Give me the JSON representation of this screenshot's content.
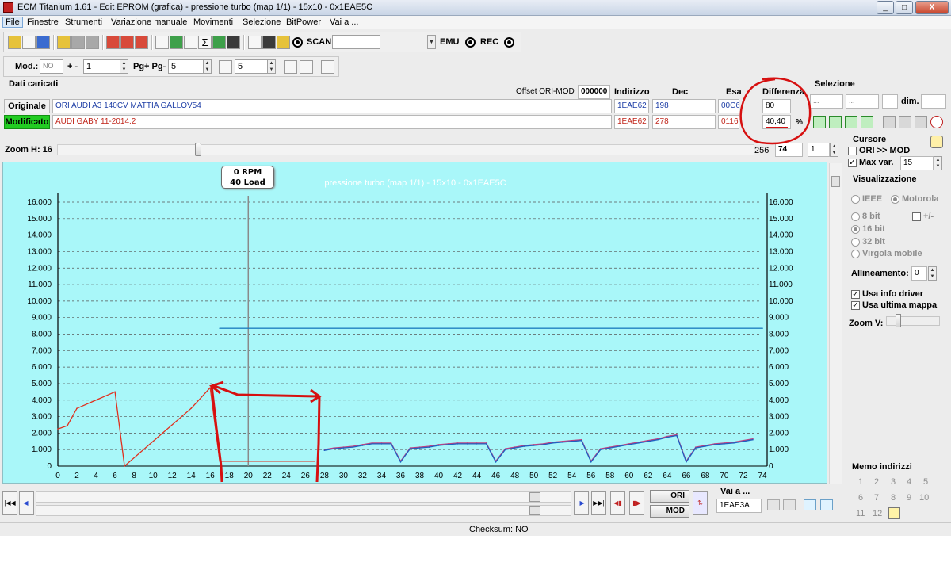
{
  "window": {
    "title": "ECM Titanium 1.61 - Edit EPROM (grafica) - pressione turbo (map 1/1) - 15x10 - 0x1EAE5C",
    "minimize": "_",
    "maximize": "□",
    "close": "X"
  },
  "menu": [
    "File",
    "Finestre",
    "Strumenti",
    "Variazione manuale",
    "Movimenti",
    "Selezione",
    "BitPower",
    "Vai a ..."
  ],
  "toolbar1": {
    "scan_label": "SCAN",
    "emu_label": "EMU",
    "rec_label": "REC"
  },
  "toolbar2": {
    "mod_label": "Mod.:",
    "mod_value": "NO",
    "plusminus_label": "+ -",
    "plusminus_value": "1",
    "pg_label": "Pg+ Pg-",
    "pg_value": "5",
    "p_value": "5"
  },
  "data_panel": {
    "title": "Dati caricati",
    "offset_label": "Offset ORI-MOD",
    "offset_value": "000000",
    "col_indirizzo": "Indirizzo",
    "col_dec": "Dec",
    "col_esa": "Esa",
    "col_differenza": "Differenza",
    "selezione_label": "Selezione",
    "dim_label": "dim.",
    "sel_from": "...",
    "sel_to": "...",
    "originale": {
      "label": "Originale",
      "name": "ORI AUDI A3 140CV MATTIA GALLOV54",
      "indirizzo": "1EAE62",
      "dec": "198",
      "esa": "00C6",
      "diff": "80"
    },
    "modificato": {
      "label": "Modificato",
      "name": "AUDI GABY 11-2014.2",
      "indirizzo": "1EAE62",
      "dec": "278",
      "esa": "0116",
      "diff": "40,40",
      "diff_unit": "%"
    }
  },
  "zoom": {
    "label": "Zoom H: 16",
    "position": 0.2,
    "right_min": "256",
    "right_value": "74",
    "right_step": "1"
  },
  "chart_data": {
    "type": "line",
    "title": "pressione turbo (map 1/1) - 15x10 - 0x1EAE5C",
    "cursor_label_line1": "0 RPM",
    "cursor_label_line2": "40 Load",
    "cursor_x": 20,
    "xlim": [
      0,
      74
    ],
    "ylim": [
      0,
      16
    ],
    "xticks": [
      "0",
      "2",
      "4",
      "6",
      "8",
      "10",
      "12",
      "14",
      "16",
      "18",
      "20",
      "22",
      "24",
      "26",
      "28",
      "30",
      "32",
      "34",
      "36",
      "38",
      "40",
      "42",
      "44",
      "46",
      "48",
      "50",
      "52",
      "54",
      "56",
      "58",
      "60",
      "62",
      "64",
      "66",
      "68",
      "70",
      "72",
      "74"
    ],
    "yticks": [
      "0",
      "1.000",
      "2.000",
      "3.000",
      "4.000",
      "5.000",
      "6.000",
      "7.000",
      "8.000",
      "9.000",
      "10.000",
      "11.000",
      "12.000",
      "13.000",
      "14.000",
      "15.000",
      "16.000"
    ],
    "grid": true,
    "series": [
      {
        "color": "#e0301e",
        "x": [
          0,
          1,
          2,
          6,
          7,
          11,
          14,
          16
        ],
        "y": [
          2.25,
          2.45,
          3.5,
          4.5,
          0,
          2.0,
          3.5,
          4.75
        ]
      },
      {
        "color": "#e0301e",
        "x": [
          16,
          17,
          27
        ],
        "y": [
          4.75,
          0.3,
          0.3
        ]
      },
      {
        "color": "#c04080",
        "x": [
          28,
          29,
          30,
          31,
          32,
          33,
          34,
          35,
          36,
          37,
          38,
          39,
          40,
          41,
          42,
          43,
          44,
          45,
          46,
          47,
          48,
          49,
          50,
          51,
          52,
          53,
          54,
          55,
          56,
          57,
          58,
          59,
          60,
          61,
          62,
          63,
          64,
          65,
          66,
          67,
          68,
          69,
          70,
          71,
          72,
          73
        ],
        "y": [
          1.0,
          1.1,
          1.15,
          1.2,
          1.3,
          1.4,
          1.4,
          1.4,
          0.3,
          1.1,
          1.15,
          1.2,
          1.3,
          1.35,
          1.4,
          1.4,
          1.4,
          1.4,
          0.3,
          1.05,
          1.15,
          1.25,
          1.3,
          1.35,
          1.45,
          1.5,
          1.55,
          1.6,
          0.3,
          1.05,
          1.15,
          1.25,
          1.35,
          1.45,
          1.55,
          1.65,
          1.8,
          1.9,
          0.3,
          1.15,
          1.25,
          1.35,
          1.4,
          1.45,
          1.55,
          1.65
        ]
      },
      {
        "color": "#2060c0",
        "x": [
          28,
          29,
          30,
          31,
          32,
          33,
          34,
          35,
          36,
          37,
          38,
          39,
          40,
          41,
          42,
          43,
          44,
          45,
          46,
          47,
          48,
          49,
          50,
          51,
          52,
          53,
          54,
          55,
          56,
          57,
          58,
          59,
          60,
          61,
          62,
          63,
          64,
          65,
          66,
          67,
          68,
          69,
          70,
          71,
          72,
          73
        ],
        "y": [
          0.95,
          1.05,
          1.1,
          1.15,
          1.25,
          1.35,
          1.35,
          1.35,
          0.25,
          1.05,
          1.1,
          1.15,
          1.25,
          1.3,
          1.35,
          1.35,
          1.35,
          1.35,
          0.25,
          1.0,
          1.1,
          1.2,
          1.25,
          1.3,
          1.4,
          1.45,
          1.5,
          1.55,
          0.25,
          1.0,
          1.1,
          1.2,
          1.3,
          1.4,
          1.5,
          1.6,
          1.75,
          1.85,
          0.25,
          1.1,
          1.2,
          1.3,
          1.35,
          1.4,
          1.5,
          1.6
        ]
      },
      {
        "color": "#2080c0",
        "x": [
          17,
          74
        ],
        "y": [
          8.35,
          8.35
        ]
      }
    ]
  },
  "right_panel": {
    "cursore_label": "Cursore",
    "ori_mod_label": "ORI >> MOD",
    "ori_mod_checked": false,
    "maxvar_label": "Max var.",
    "maxvar_value": "15",
    "maxvar_checked": true,
    "visualizzazione_label": "Visualizzazione",
    "ieee_label": "IEEE",
    "motorola_label": "Motorola",
    "bit8_label": "8 bit",
    "plusminus_label": "+/-",
    "bit16_label": "16 bit",
    "bit32_label": "32 bit",
    "virgola_label": "Virgola mobile",
    "allineamento_label": "Allineamento:",
    "allineamento_value": "0",
    "usa_info_label": "Usa info driver",
    "usa_ultima_label": "Usa ultima mappa",
    "zoomv_label": "Zoom V:",
    "memo_label": "Memo indirizzi",
    "memo_numbers": [
      "1",
      "2",
      "3",
      "4",
      "5",
      "6",
      "7",
      "8",
      "9",
      "10",
      "11",
      "12"
    ]
  },
  "bottom": {
    "ori_btn": "ORI",
    "mod_btn": "MOD",
    "vai_label": "Vai a ...",
    "vai_value": "1EAE3A",
    "checksum": "Checksum: NO"
  }
}
